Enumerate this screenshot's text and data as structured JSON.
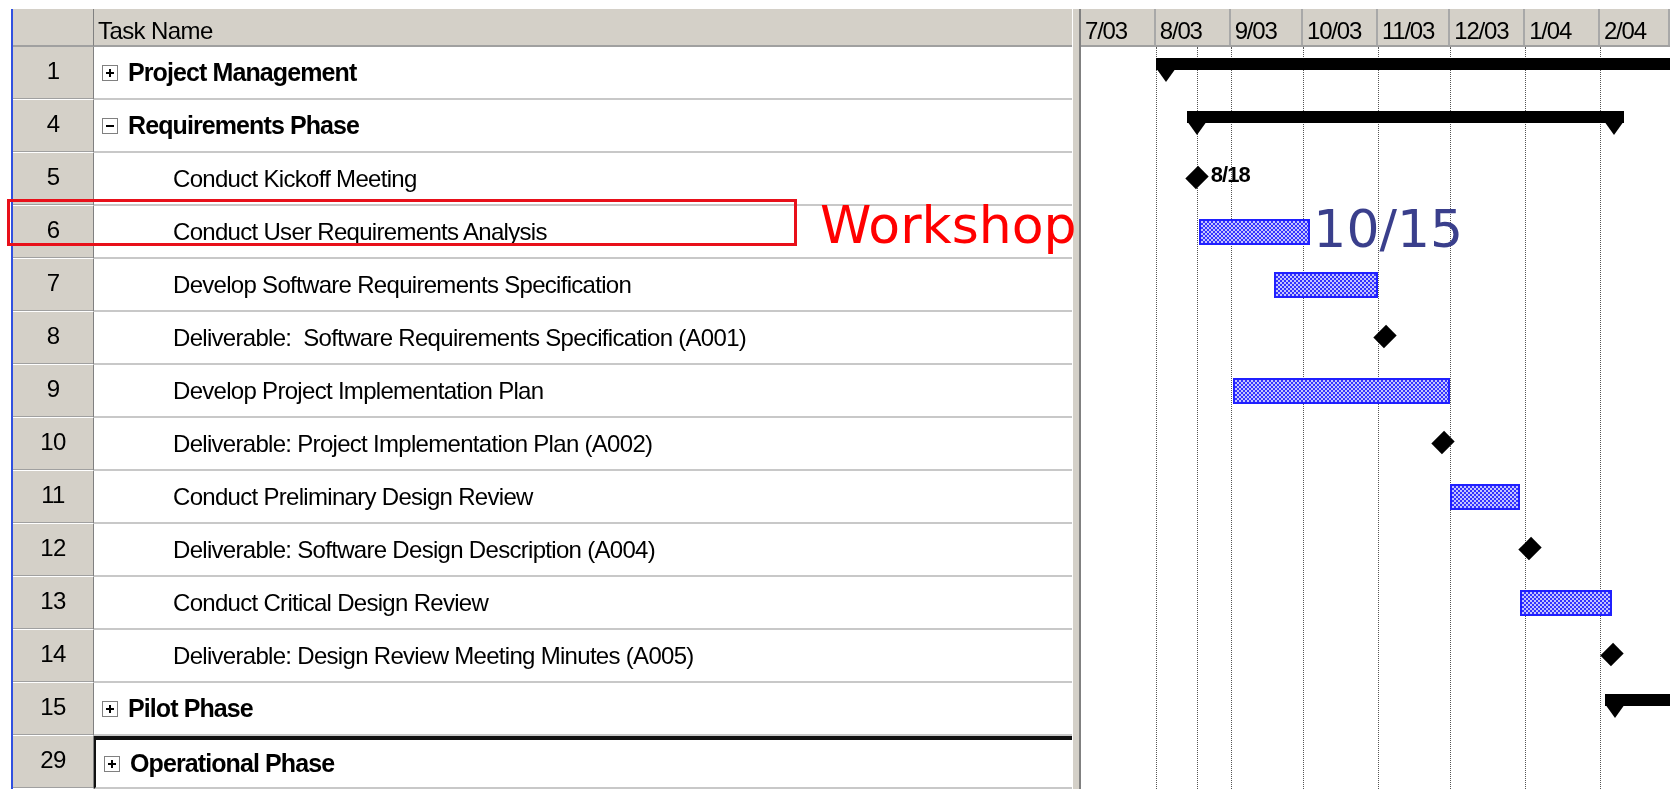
{
  "table": {
    "name_header": "Task Name"
  },
  "gantt": {
    "months": [
      "7/03",
      "8/03",
      "9/03",
      "10/03",
      "11/03",
      "12/03",
      "1/04",
      "2/04"
    ]
  },
  "rows": [
    {
      "id": "1",
      "name": "Project Management",
      "kind": "summary",
      "expanded": false,
      "selected": false
    },
    {
      "id": "4",
      "name": "Requirements Phase",
      "kind": "summary",
      "expanded": true,
      "selected": false
    },
    {
      "id": "5",
      "name": "Conduct Kickoff Meeting",
      "kind": "milestone",
      "selected": false,
      "date_label": "8/18"
    },
    {
      "id": "6",
      "name": "Conduct User Requirements Analysis",
      "kind": "task",
      "selected": false,
      "highlighted": true,
      "note": "Workshop",
      "callout": "10/15"
    },
    {
      "id": "7",
      "name": "Develop Software Requirements Specification",
      "kind": "task",
      "selected": false
    },
    {
      "id": "8",
      "name": "Deliverable:  Software Requirements Specification (A001)",
      "kind": "milestone",
      "selected": false
    },
    {
      "id": "9",
      "name": "Develop Project Implementation Plan",
      "kind": "task",
      "selected": false
    },
    {
      "id": "10",
      "name": "Deliverable: Project Implementation Plan (A002)",
      "kind": "milestone",
      "selected": false
    },
    {
      "id": "11",
      "name": "Conduct Preliminary Design Review",
      "kind": "task",
      "selected": false
    },
    {
      "id": "12",
      "name": "Deliverable: Software Design Description (A004)",
      "kind": "milestone",
      "selected": false
    },
    {
      "id": "13",
      "name": "Conduct Critical Design Review",
      "kind": "task",
      "selected": false
    },
    {
      "id": "14",
      "name": "Deliverable: Design Review Meeting Minutes (A005)",
      "kind": "milestone",
      "selected": false
    },
    {
      "id": "15",
      "name": "Pilot Phase",
      "kind": "summary",
      "expanded": false,
      "selected": false
    },
    {
      "id": "29",
      "name": "Operational Phase",
      "kind": "summary",
      "expanded": false,
      "selected": true
    }
  ]
}
